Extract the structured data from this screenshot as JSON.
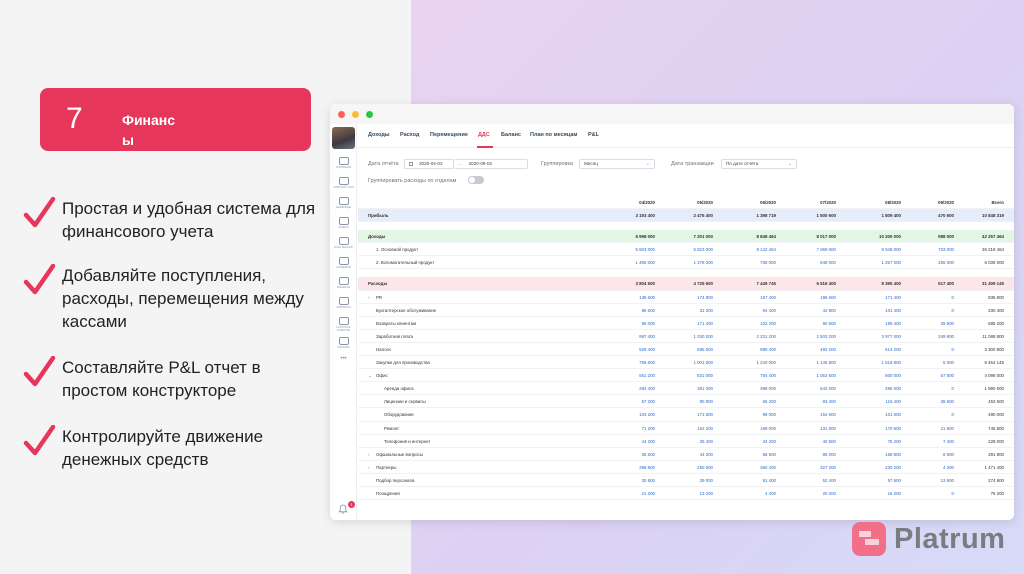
{
  "badge": {
    "number": "7",
    "title": "Финанс\nы"
  },
  "features": [
    "Простая и удобная система для финансового учета",
    "Добавляйте поступления, расходы, перемещения между кассами",
    "Составляйте P&L отчет в простом конструкторе",
    "Контролируйте движение денежных средств"
  ],
  "logo": {
    "text": "Platrum"
  },
  "colors": {
    "accent": "#e6375a",
    "number_blue": "#2f69c8",
    "profit_row": "#e5edfb",
    "income_row": "#e3f5e3",
    "expense_row": "#fde6ea"
  },
  "window": {
    "tabs": [
      "Доходы",
      "Расход",
      "Перемещение",
      "ДДС",
      "Баланс",
      "План по месяцам",
      "P&L"
    ],
    "active_tab": "ДДС",
    "sidebar": [
      {
        "icon": "company-icon",
        "label": "КОМПАНИЯ"
      },
      {
        "icon": "desk-icon",
        "label": "РАБОЧИЙ СТОЛ"
      },
      {
        "icon": "monitor-icon",
        "label": "ДАШБОРДЫ"
      },
      {
        "icon": "tasks-icon",
        "label": "ЗАДАЧИ"
      },
      {
        "icon": "knowledge-icon",
        "label": "БАЗА ЗНАНИЙ"
      },
      {
        "icon": "academy-icon",
        "label": "АКАДЕМИЯ"
      },
      {
        "icon": "finance-icon",
        "label": "ФИНАНСЫ"
      },
      {
        "icon": "wallet-icon",
        "label": "ЗАРПЛАТЫ"
      },
      {
        "icon": "quality-icon",
        "label": "КОНТРОЛЬ КАЧЕСТВА"
      },
      {
        "icon": "shop-icon",
        "label": "МАГАЗИН"
      },
      {
        "icon": "more-icon",
        "label": "•••"
      }
    ],
    "notification_count": "1",
    "filters": {
      "report_date_label": "Дата отчёта",
      "date_from": "2020-04-02",
      "date_to": "2020-09-02",
      "date_separator": "→",
      "grouping_label": "Группировка",
      "grouping_value": "Месяц",
      "transaction_date_label": "Дата транзакции",
      "transaction_date_value": "По дате отчёта",
      "group_by_department_label": "Группировать расходы по отделам"
    },
    "table": {
      "columns": [
        "04/2020",
        "05/2020",
        "06/2020",
        "07/2020",
        "08/2020",
        "09/2020",
        "Всего"
      ],
      "rows": [
        {
          "name": "Прибыль",
          "style": "profit",
          "values": [
            "3 193 400",
            "2 475 400",
            "1 398 719",
            "1 500 600",
            "1 809 400",
            "470 600",
            "10 848 319"
          ]
        },
        {
          "name": "",
          "style": "gap",
          "values": []
        },
        {
          "name": "Доходы",
          "style": "income",
          "values": [
            "6 998 000",
            "7 201 000",
            "8 848 464",
            "8 017 000",
            "10 205 000",
            "988 000",
            "42 257 464"
          ]
        },
        {
          "name": "1. Основной продукт",
          "style": "item",
          "values": [
            "5 503 000",
            "5 823 000",
            "8 142 464",
            "7 069 000",
            "8 948 000",
            "733 000",
            "36 218 464"
          ]
        },
        {
          "name": "2. Вспомогательный продукт",
          "style": "item",
          "values": [
            "1 495 000",
            "1 378 000",
            "706 000",
            "948 000",
            "1 257 000",
            "255 000",
            "6 039 000"
          ]
        },
        {
          "name": "",
          "style": "gap",
          "values": []
        },
        {
          "name": "Расходы",
          "style": "expense",
          "values": [
            "3 804 600",
            "4 725 600",
            "7 449 745",
            "6 516 400",
            "8 395 400",
            "517 400",
            "31 409 145"
          ]
        },
        {
          "name": "PR",
          "style": "group",
          "values": [
            "135 600",
            "174 800",
            "157 400",
            "196 600",
            "171 400",
            "0",
            "835 800"
          ]
        },
        {
          "name": "Бухгалтерское обслуживание",
          "style": "item",
          "values": [
            "86 600",
            "31 200",
            "94 400",
            "44 800",
            "101 400",
            "0",
            "330 400"
          ]
        },
        {
          "name": "Возвраты клиентам",
          "style": "item",
          "values": [
            "96 000",
            "171 400",
            "102 200",
            "90 600",
            "195 400",
            "29 600",
            "685 200"
          ]
        },
        {
          "name": "Заработная плата",
          "style": "item",
          "values": [
            "997 400",
            "1 030 200",
            "2 231 200",
            "2 503 200",
            "3 977 000",
            "349 800",
            "11 088 800"
          ]
        },
        {
          "name": "Налоги",
          "style": "item",
          "values": [
            "529 400",
            "685 600",
            "989 400",
            "482 200",
            "614 200",
            "0",
            "3 300 800"
          ]
        },
        {
          "name": "Закупки для производства",
          "style": "item",
          "values": [
            "759 600",
            "1 001 600",
            "1 240 000",
            "1 145 800",
            "1 518 800",
            "5 000",
            "6 454 145"
          ]
        },
        {
          "name": "Офис",
          "style": "group-open",
          "values": [
            "561 200",
            "831 000",
            "784 400",
            "1 053 600",
            "800 000",
            "67 800",
            "4 098 000"
          ]
        },
        {
          "name": "Аренда офиса",
          "style": "sub",
          "values": [
            "284 400",
            "381 000",
            "398 000",
            "642 000",
            "285 000",
            "0",
            "1 990 600"
          ]
        },
        {
          "name": "Лицензии и сервисы",
          "style": "sub",
          "values": [
            "57 200",
            "90 800",
            "65 200",
            "83 400",
            "116 400",
            "38 600",
            "453 600"
          ]
        },
        {
          "name": "Оборудование",
          "style": "sub",
          "values": [
            "104 200",
            "171 600",
            "98 000",
            "154 600",
            "101 600",
            "0",
            "480 000"
          ]
        },
        {
          "name": "Ремонт",
          "style": "sub",
          "values": [
            "71 200",
            "162 200",
            "189 000",
            "131 000",
            "170 600",
            "21 800",
            "745 800"
          ]
        },
        {
          "name": "Телефония и интернет",
          "style": "sub",
          "values": [
            "44 200",
            "25 400",
            "34 200",
            "40 600",
            "76 200",
            "7 400",
            "228 000"
          ]
        },
        {
          "name": "Офшиальные вопросы",
          "style": "group",
          "values": [
            "35 600",
            "44 200",
            "58 600",
            "86 000",
            "158 800",
            "8 600",
            "391 800"
          ]
        },
        {
          "name": "Партнеры",
          "style": "group",
          "values": [
            "298 800",
            "250 600",
            "360 400",
            "327 200",
            "230 200",
            "4 200",
            "1 471 400"
          ]
        },
        {
          "name": "Подбор персонала",
          "style": "item",
          "values": [
            "30 800",
            "29 000",
            "91 400",
            "52 400",
            "57 600",
            "13 600",
            "274 800"
          ]
        },
        {
          "name": "Поощрения",
          "style": "item",
          "values": [
            "21 200",
            "13 200",
            "4 400",
            "20 200",
            "16 200",
            "0",
            "75 200"
          ]
        }
      ]
    }
  }
}
